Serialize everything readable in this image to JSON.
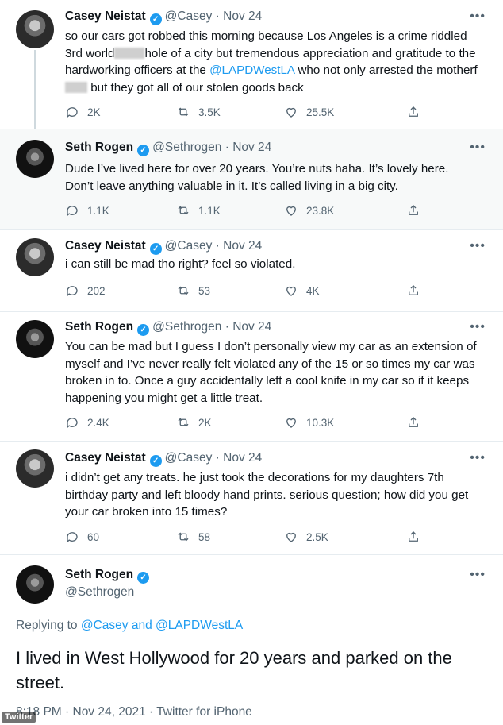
{
  "tweets": [
    {
      "name": "Casey Neistat",
      "handle": "@Casey",
      "date": "Nov 24",
      "text_parts": {
        "a": "so our cars got robbed this morning because Los Angeles is a crime riddled 3rd world",
        "b": "hole of a city but tremendous appreciation and gratitude to the hardworking officers at the ",
        "mention": "@LAPDWestLA",
        "c": " who not only arrested the motherf",
        "d": " but they got all of our stolen goods back"
      },
      "replies": "2K",
      "retweets": "3.5K",
      "likes": "25.5K"
    },
    {
      "name": "Seth Rogen",
      "handle": "@Sethrogen",
      "date": "Nov 24",
      "text": "Dude I’ve lived here for over 20 years. You’re nuts haha. It’s lovely here. Don’t leave anything valuable in it. It’s called living in a big city.",
      "replies": "1.1K",
      "retweets": "1.1K",
      "likes": "23.8K"
    },
    {
      "name": "Casey Neistat",
      "handle": "@Casey",
      "date": "Nov 24",
      "text": "i can still be mad tho right?  feel so violated.",
      "replies": "202",
      "retweets": "53",
      "likes": "4K"
    },
    {
      "name": "Seth Rogen",
      "handle": "@Sethrogen",
      "date": "Nov 24",
      "text": "You can be mad but I guess I don’t personally view my car as an extension of myself and I’ve never really felt violated any of the 15 or so times my car was broken in to. Once a guy accidentally left a cool knife in my car so if it keeps happening you might get a little treat.",
      "replies": "2.4K",
      "retweets": "2K",
      "likes": "10.3K"
    },
    {
      "name": "Casey Neistat",
      "handle": "@Casey",
      "date": "Nov 24",
      "text": "i didn’t get any treats. he just took the decorations for my daughters 7th birthday party and left bloody hand prints.  serious question; how did you get your car broken into 15 times?",
      "replies": "60",
      "retweets": "58",
      "likes": "2.5K"
    }
  ],
  "main_tweet": {
    "name": "Seth Rogen",
    "handle": "@Sethrogen",
    "replying_label": "Replying to",
    "replying_to": "@Casey and @LAPDWestLA",
    "text": "I lived in West Hollywood for 20 years and parked on the street.",
    "meta": "8:18 PM · Nov 24, 2021 · Twitter for iPhone"
  },
  "ui": {
    "more": "•••",
    "verified": "✓",
    "dot": "·"
  },
  "watermark": "Twitter",
  "colors": {
    "link": "#1d9bf0",
    "muted": "#536471",
    "highlight_bg": "#f7f9f9"
  }
}
